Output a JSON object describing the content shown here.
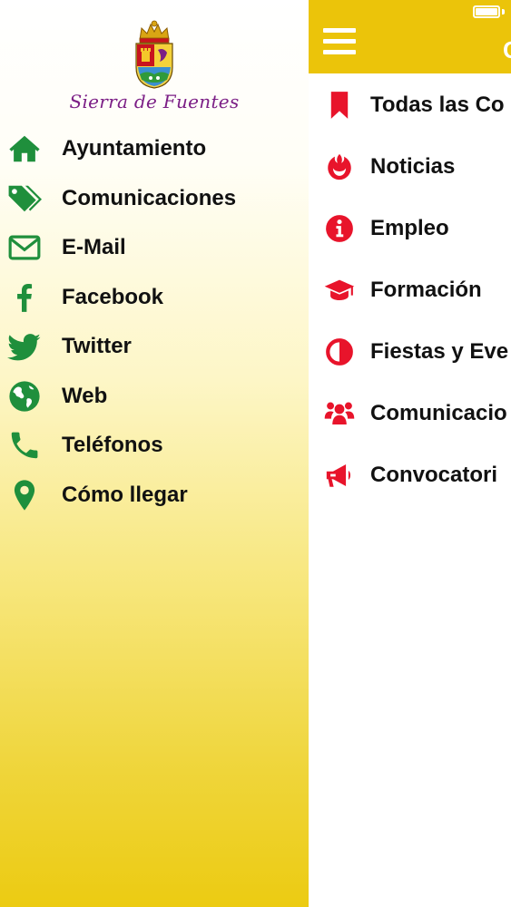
{
  "drawer": {
    "town_name": "Sierra de Fuentes",
    "items": [
      {
        "label": "Ayuntamiento",
        "icon": "home-icon"
      },
      {
        "label": "Comunicaciones",
        "icon": "tags-icon"
      },
      {
        "label": "E-Mail",
        "icon": "envelope-icon"
      },
      {
        "label": "Facebook",
        "icon": "facebook-icon"
      },
      {
        "label": "Twitter",
        "icon": "twitter-icon"
      },
      {
        "label": "Web",
        "icon": "globe-icon"
      },
      {
        "label": "Teléfonos",
        "icon": "phone-icon"
      },
      {
        "label": "Cómo llegar",
        "icon": "map-marker-icon"
      }
    ]
  },
  "header": {
    "title": "C"
  },
  "categories": [
    {
      "label": "Todas las Co",
      "icon": "bookmark-icon"
    },
    {
      "label": "Noticias",
      "icon": "rebel-icon"
    },
    {
      "label": "Empleo",
      "icon": "info-circle-icon"
    },
    {
      "label": "Formación",
      "icon": "graduation-cap-icon"
    },
    {
      "label": "Fiestas y Eve",
      "icon": "adjust-icon"
    },
    {
      "label": "Comunicacio",
      "icon": "users-icon"
    },
    {
      "label": "Convocatori",
      "icon": "megaphone-icon"
    }
  ],
  "colors": {
    "accent_yellow": "#ebc40a",
    "drawer_icon_green": "#1f8f3c",
    "category_icon_red": "#e8142b",
    "town_name_purple": "#7c1f86"
  }
}
